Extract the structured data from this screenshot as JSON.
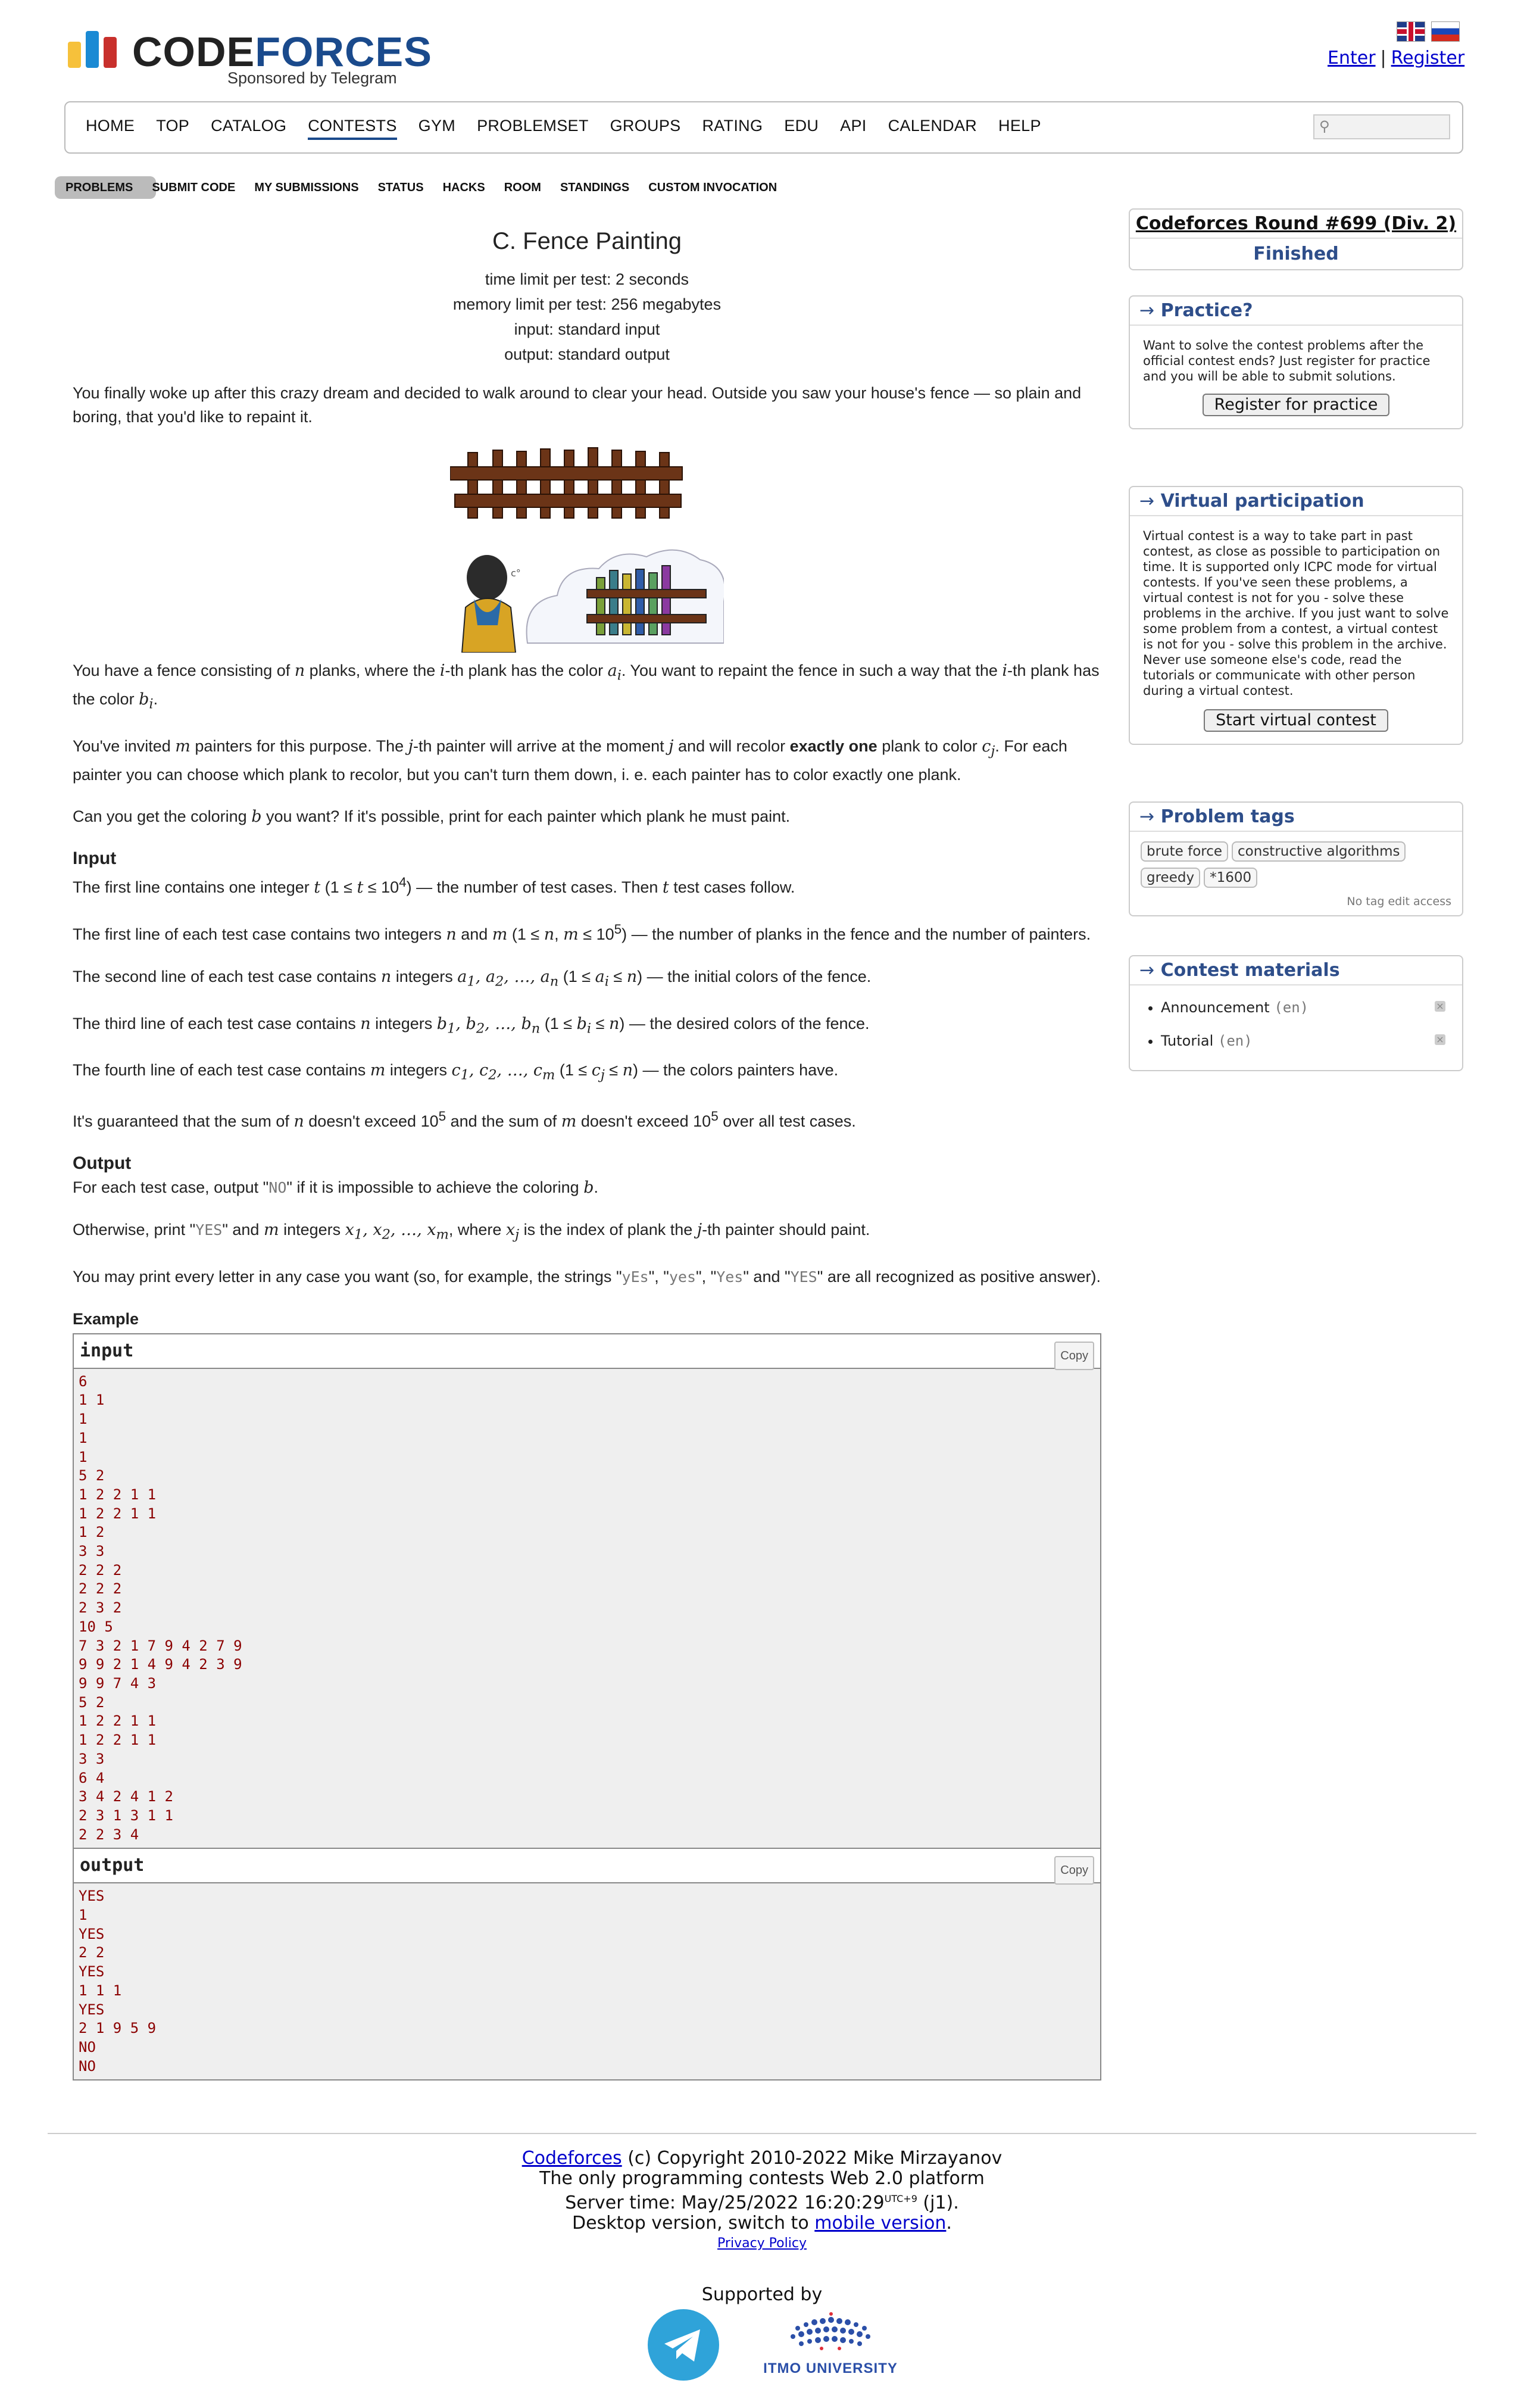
{
  "header": {
    "logo_text_a": "CODE",
    "logo_text_b": "FORCES",
    "sponsor": "Sponsored by Telegram",
    "enter": "Enter",
    "sep": "|",
    "register": "Register"
  },
  "menu": {
    "items": [
      "HOME",
      "TOP",
      "CATALOG",
      "CONTESTS",
      "GYM",
      "PROBLEMSET",
      "GROUPS",
      "RATING",
      "EDU",
      "API",
      "CALENDAR",
      "HELP"
    ],
    "active": "CONTESTS"
  },
  "submenu": {
    "items": [
      "PROBLEMS",
      "SUBMIT CODE",
      "MY SUBMISSIONS",
      "STATUS",
      "HACKS",
      "ROOM",
      "STANDINGS",
      "CUSTOM INVOCATION"
    ]
  },
  "problem": {
    "title": "C. Fence Painting",
    "time_limit": "time limit per test: 2 seconds",
    "memory_limit": "memory limit per test: 256 megabytes",
    "input": "input: standard input",
    "output": "output: standard output",
    "intro": "You finally woke up after this crazy dream and decided to walk around to clear your head. Outside you saw your house's fence — so plain and boring, that you'd like to repaint it.",
    "input_heading": "Input",
    "output_heading": "Output",
    "example_heading": "Example",
    "yes_examples": [
      "yEs",
      "yes",
      "Yes",
      "YES"
    ]
  },
  "samples": {
    "input_label": "input",
    "output_label": "output",
    "copy": "Copy",
    "input": "6\n1 1\n1\n1\n1\n5 2\n1 2 2 1 1\n1 2 2 1 1\n1 2\n3 3\n2 2 2\n2 2 2\n2 3 2\n10 5\n7 3 2 1 7 9 4 2 7 9\n9 9 2 1 4 9 4 2 3 9\n9 9 7 4 3\n5 2\n1 2 2 1 1\n1 2 2 1 1\n3 3\n6 4\n3 4 2 4 1 2\n2 3 1 3 1 1\n2 2 3 4",
    "output": "YES\n1\nYES\n2 2\nYES\n1 1 1\nYES\n2 1 9 5 9\nNO\nNO"
  },
  "sidebar": {
    "contest_name": "Codeforces Round #699 (Div. 2)",
    "contest_status": "Finished",
    "practice_title": "Practice?",
    "practice_text": "Want to solve the contest problems after the official contest ends? Just register for practice and you will be able to submit solutions.",
    "practice_button": "Register for practice",
    "virtual_title": "Virtual participation",
    "virtual_text": "Virtual contest is a way to take part in past contest, as close as possible to participation on time. It is supported only ICPC mode for virtual contests. If you've seen these problems, a virtual contest is not for you - solve these problems in the archive. If you just want to solve some problem from a contest, a virtual contest is not for you - solve this problem in the archive. Never use someone else's code, read the tutorials or communicate with other person during a virtual contest.",
    "virtual_button": "Start virtual contest",
    "tags_title": "Problem tags",
    "tags": [
      "brute force",
      "constructive algorithms",
      "greedy",
      "*1600"
    ],
    "no_tag_edit": "No tag edit access",
    "materials_title": "Contest materials",
    "materials": [
      {
        "label": "Announcement",
        "lang": "(en)"
      },
      {
        "label": "Tutorial",
        "lang": "(en)"
      }
    ]
  },
  "footer": {
    "brand_link": "Codeforces",
    "copyright": "(c) Copyright 2010-2022 Mike Mirzayanov",
    "tagline": "The only programming contests Web 2.0 platform",
    "server_time_prefix": "Server time: May/25/2022 16:20:29",
    "server_time_tz": "UTC+9",
    "server_time_suffix": "(j1).",
    "desktop_prefix": "Desktop version, switch to",
    "mobile_link": "mobile version",
    "privacy": "Privacy Policy",
    "supported_by": "Supported by",
    "itmo": "ITMO UNIVERSITY"
  },
  "colors": {
    "accent": "#2e4e8a",
    "logo_yellow": "#f6c13b",
    "logo_blue": "#1a8ad4",
    "logo_red": "#c8302c",
    "sample_text": "#8b0000",
    "telegram": "#2fa3d9"
  }
}
